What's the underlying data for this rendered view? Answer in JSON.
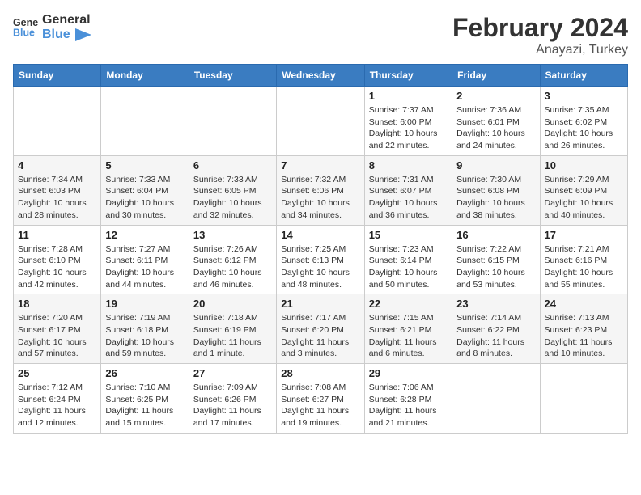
{
  "header": {
    "logo_line1": "General",
    "logo_line2": "Blue",
    "title": "February 2024",
    "location": "Anayazi, Turkey"
  },
  "weekdays": [
    "Sunday",
    "Monday",
    "Tuesday",
    "Wednesday",
    "Thursday",
    "Friday",
    "Saturday"
  ],
  "weeks": [
    [
      {
        "day": "",
        "info": ""
      },
      {
        "day": "",
        "info": ""
      },
      {
        "day": "",
        "info": ""
      },
      {
        "day": "",
        "info": ""
      },
      {
        "day": "1",
        "info": "Sunrise: 7:37 AM\nSunset: 6:00 PM\nDaylight: 10 hours\nand 22 minutes."
      },
      {
        "day": "2",
        "info": "Sunrise: 7:36 AM\nSunset: 6:01 PM\nDaylight: 10 hours\nand 24 minutes."
      },
      {
        "day": "3",
        "info": "Sunrise: 7:35 AM\nSunset: 6:02 PM\nDaylight: 10 hours\nand 26 minutes."
      }
    ],
    [
      {
        "day": "4",
        "info": "Sunrise: 7:34 AM\nSunset: 6:03 PM\nDaylight: 10 hours\nand 28 minutes."
      },
      {
        "day": "5",
        "info": "Sunrise: 7:33 AM\nSunset: 6:04 PM\nDaylight: 10 hours\nand 30 minutes."
      },
      {
        "day": "6",
        "info": "Sunrise: 7:33 AM\nSunset: 6:05 PM\nDaylight: 10 hours\nand 32 minutes."
      },
      {
        "day": "7",
        "info": "Sunrise: 7:32 AM\nSunset: 6:06 PM\nDaylight: 10 hours\nand 34 minutes."
      },
      {
        "day": "8",
        "info": "Sunrise: 7:31 AM\nSunset: 6:07 PM\nDaylight: 10 hours\nand 36 minutes."
      },
      {
        "day": "9",
        "info": "Sunrise: 7:30 AM\nSunset: 6:08 PM\nDaylight: 10 hours\nand 38 minutes."
      },
      {
        "day": "10",
        "info": "Sunrise: 7:29 AM\nSunset: 6:09 PM\nDaylight: 10 hours\nand 40 minutes."
      }
    ],
    [
      {
        "day": "11",
        "info": "Sunrise: 7:28 AM\nSunset: 6:10 PM\nDaylight: 10 hours\nand 42 minutes."
      },
      {
        "day": "12",
        "info": "Sunrise: 7:27 AM\nSunset: 6:11 PM\nDaylight: 10 hours\nand 44 minutes."
      },
      {
        "day": "13",
        "info": "Sunrise: 7:26 AM\nSunset: 6:12 PM\nDaylight: 10 hours\nand 46 minutes."
      },
      {
        "day": "14",
        "info": "Sunrise: 7:25 AM\nSunset: 6:13 PM\nDaylight: 10 hours\nand 48 minutes."
      },
      {
        "day": "15",
        "info": "Sunrise: 7:23 AM\nSunset: 6:14 PM\nDaylight: 10 hours\nand 50 minutes."
      },
      {
        "day": "16",
        "info": "Sunrise: 7:22 AM\nSunset: 6:15 PM\nDaylight: 10 hours\nand 53 minutes."
      },
      {
        "day": "17",
        "info": "Sunrise: 7:21 AM\nSunset: 6:16 PM\nDaylight: 10 hours\nand 55 minutes."
      }
    ],
    [
      {
        "day": "18",
        "info": "Sunrise: 7:20 AM\nSunset: 6:17 PM\nDaylight: 10 hours\nand 57 minutes."
      },
      {
        "day": "19",
        "info": "Sunrise: 7:19 AM\nSunset: 6:18 PM\nDaylight: 10 hours\nand 59 minutes."
      },
      {
        "day": "20",
        "info": "Sunrise: 7:18 AM\nSunset: 6:19 PM\nDaylight: 11 hours\nand 1 minute."
      },
      {
        "day": "21",
        "info": "Sunrise: 7:17 AM\nSunset: 6:20 PM\nDaylight: 11 hours\nand 3 minutes."
      },
      {
        "day": "22",
        "info": "Sunrise: 7:15 AM\nSunset: 6:21 PM\nDaylight: 11 hours\nand 6 minutes."
      },
      {
        "day": "23",
        "info": "Sunrise: 7:14 AM\nSunset: 6:22 PM\nDaylight: 11 hours\nand 8 minutes."
      },
      {
        "day": "24",
        "info": "Sunrise: 7:13 AM\nSunset: 6:23 PM\nDaylight: 11 hours\nand 10 minutes."
      }
    ],
    [
      {
        "day": "25",
        "info": "Sunrise: 7:12 AM\nSunset: 6:24 PM\nDaylight: 11 hours\nand 12 minutes."
      },
      {
        "day": "26",
        "info": "Sunrise: 7:10 AM\nSunset: 6:25 PM\nDaylight: 11 hours\nand 15 minutes."
      },
      {
        "day": "27",
        "info": "Sunrise: 7:09 AM\nSunset: 6:26 PM\nDaylight: 11 hours\nand 17 minutes."
      },
      {
        "day": "28",
        "info": "Sunrise: 7:08 AM\nSunset: 6:27 PM\nDaylight: 11 hours\nand 19 minutes."
      },
      {
        "day": "29",
        "info": "Sunrise: 7:06 AM\nSunset: 6:28 PM\nDaylight: 11 hours\nand 21 minutes."
      },
      {
        "day": "",
        "info": ""
      },
      {
        "day": "",
        "info": ""
      }
    ]
  ]
}
